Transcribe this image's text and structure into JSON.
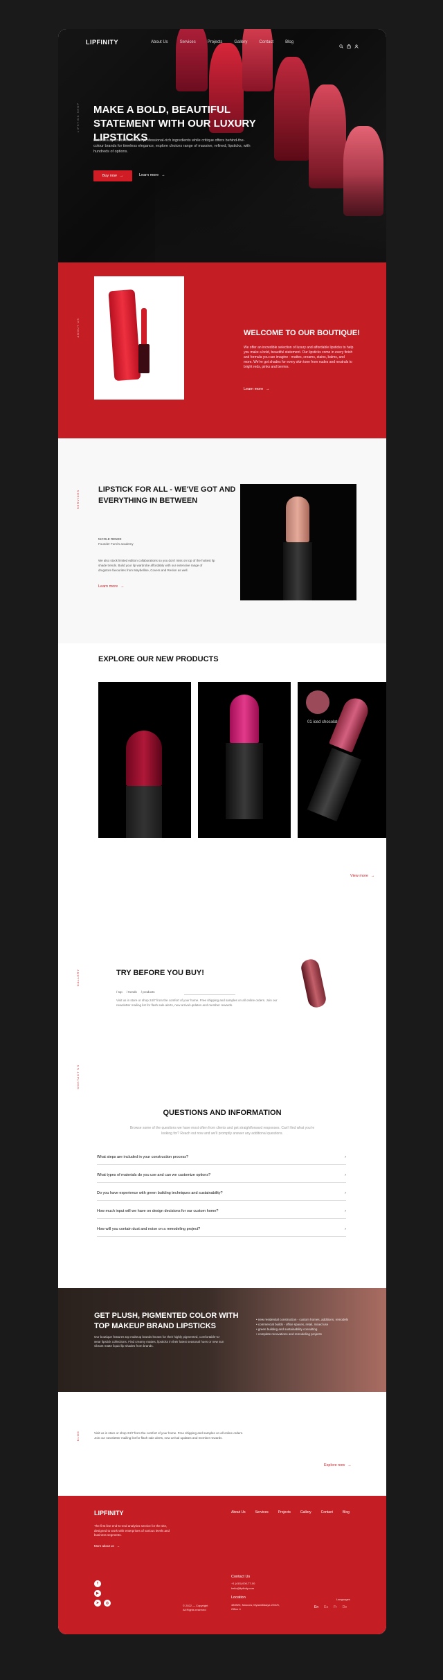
{
  "brand": "LIPFINITY",
  "nav": [
    "About Us",
    "Services",
    "Projects",
    "Gallery",
    "Contact",
    "Blog"
  ],
  "nav_icons": [
    "search-icon",
    "bag-icon",
    "user-icon"
  ],
  "hero": {
    "title": "MAKE A BOLD, BEAUTIFUL STATEMENT WITH OUR LUXURY LIPSTICKS",
    "text": "Bold beauty crafts these with professional-rich ingredients while critique offers behind-the-colour brands for timeless elegance, explore choices range of massive, refined, lipsticks, with hundreds of options.",
    "buy_label": "Buy now",
    "learn_label": "Learn more",
    "side_label": "LIPSTICK SHOP"
  },
  "welcome": {
    "title": "WELCOME TO OUR BOUTIQUE!",
    "text": "We offer an incredible selection of luxury and affordable lipsticks to help you make a bold, beautiful statement. Our lipsticks come in every finish and formula you can imagine - mattes, creams, stains, balms, and more. We've got shades for every skin tone from nudes and neutrals to bright reds, pinks and berries.",
    "link": "Learn more",
    "side_label": "ABOUT US"
  },
  "forall": {
    "title": "LIPSTICK FOR ALL - WE'VE GOT AND EVERYTHING IN BETWEEN",
    "meta_name": "NICOLE RENEE",
    "meta_role": "Founder Fumi's academy",
    "text": "We also stock limited edition collaborations so you don't miss on top of the hottest lip shade trends. Build your lip wardrobe affordably with our extensive range of drugstore favourites from Maybelline, Covers and Revlon as well.",
    "link": "Learn more",
    "side_label": "SERVICES"
  },
  "explore": {
    "title": "EXPLORE OUR NEW PRODUCTS",
    "swatch_label": "01 iced chocolate",
    "link": "View more"
  },
  "try": {
    "title": "TRY BEFORE YOU BUY!",
    "crumbs": [
      "/ top",
      "/ trends",
      "/ products"
    ],
    "text": "Visit us in store or shop 24/7 from the comfort of your home. Free shipping and samples on all online orders. Join our newsletter mailing list for flash sale alerts, new arrival updates and member rewards.",
    "side_label": "GALLERY"
  },
  "faq": {
    "title": "QUESTIONS AND INFORMATION",
    "sub": "Browse some of the questions we have most often from clients and get straightforward responses. Can't find what you're looking for? Reach out now and we'll promptly answer any additional questions.",
    "items": [
      "What steps are included in your construction process?",
      "What types of materials do you use and can we customize options?",
      "Do you have experience with green building techniques and sustainability?",
      "How much input will we have on design decisions for our custom home?",
      "How will you contain dust and noise on a remodeling project?"
    ],
    "side_label": "CONTACT US"
  },
  "plush": {
    "title": "GET PLUSH, PIGMENTED COLOR WITH TOP MAKEUP BRAND LIPSTICKS",
    "text": "Our boutique features top makeup brands known for their highly pigmented, comfortable-to-wear lipstick collections. Find creamy mattes, lipsticks in their latest seasonal hues or new sun vibrant matte liquid lip shades from brands.",
    "list": [
      "new residential construction - custom homes, additions, remodels",
      "commercial builds - office spaces, retail, mixed use",
      "green building and sustainability consulting",
      "complete renovations and remodeling projects"
    ]
  },
  "contact": {
    "text": "Visit us in store or shop 24/7 from the comfort of your home. Free shipping and samples on all online orders. Join our newsletter mailing list for flash sale alerts, new arrival updates and member rewards.",
    "link": "Explore now",
    "side_label": "BLOG"
  },
  "footer": {
    "brand": "LIPFINITY",
    "desc": "The first line end-to-end analytics service for the site, designed to work with enterprises of various levels and business segments.",
    "more": "More about us",
    "links": [
      "About Us",
      "Services",
      "Projects",
      "Gallery",
      "Contact",
      "Blog"
    ],
    "contact_us": "Contact Us",
    "phone": "+1 (415) 000-77-00",
    "email": "hello@lipfinity.com",
    "location_label": "Location",
    "address": "483920, Moscow, Myasnitskaya 22/2/5, Office 4",
    "languages_label": "Languages",
    "languages": [
      "En",
      "Es",
      "Fr",
      "De"
    ],
    "copyright": "© 2022 — Copyright",
    "rights": "All Rights reserved",
    "socials": [
      "facebook-icon",
      "youtube-icon",
      "telegram-icon",
      "instagram-icon"
    ]
  },
  "colors": {
    "accent": "#c41e24",
    "dark": "#0b0b0b",
    "page_bg": "#1a1a1a"
  }
}
